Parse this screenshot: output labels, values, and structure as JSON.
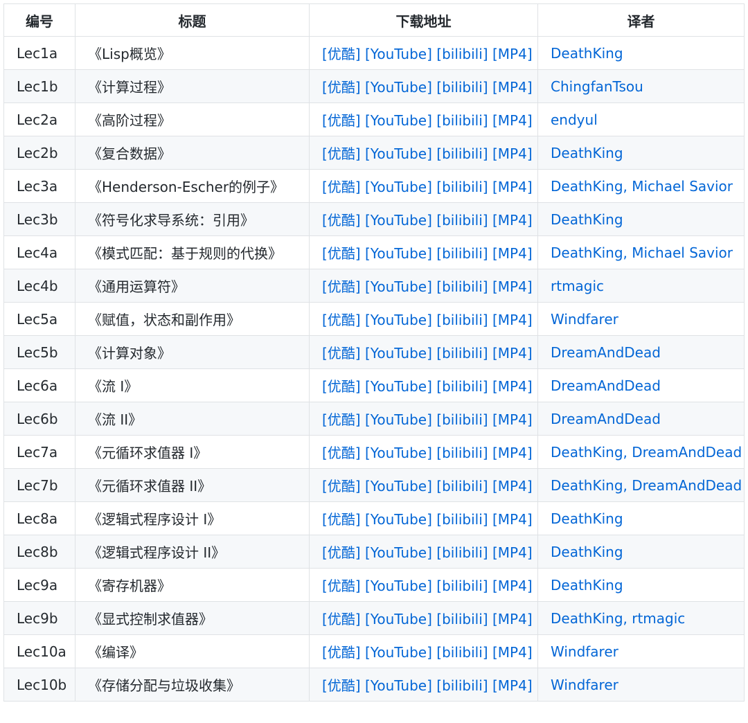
{
  "colors": {
    "link": "#0366d6",
    "border": "#dfe2e5",
    "stripe": "#f6f8fa",
    "text": "#24292e"
  },
  "table": {
    "headers": [
      "编号",
      "标题",
      "下载地址",
      "译者"
    ],
    "rows": [
      {
        "id": "Lec1a",
        "title": "《Lisp概览》",
        "links": [
          "[优酷]",
          "[YouTube]",
          "[bilibili]",
          "[MP4]"
        ],
        "translator": "DeathKing"
      },
      {
        "id": "Lec1b",
        "title": "《计算过程》",
        "links": [
          "[优酷]",
          "[YouTube]",
          "[bilibili]",
          "[MP4]"
        ],
        "translator": "ChingfanTsou"
      },
      {
        "id": "Lec2a",
        "title": "《高阶过程》",
        "links": [
          "[优酷]",
          "[YouTube]",
          "[bilibili]",
          "[MP4]"
        ],
        "translator": "endyul"
      },
      {
        "id": "Lec2b",
        "title": "《复合数据》",
        "links": [
          "[优酷]",
          "[YouTube]",
          "[bilibili]",
          "[MP4]"
        ],
        "translator": "DeathKing"
      },
      {
        "id": "Lec3a",
        "title": "《Henderson-Escher的例子》",
        "links": [
          "[优酷]",
          "[YouTube]",
          "[bilibili]",
          "[MP4]"
        ],
        "translator": "DeathKing, Michael Savior"
      },
      {
        "id": "Lec3b",
        "title": "《符号化求导系统：引用》",
        "links": [
          "[优酷]",
          "[YouTube]",
          "[bilibili]",
          "[MP4]"
        ],
        "translator": "DeathKing"
      },
      {
        "id": "Lec4a",
        "title": "《模式匹配：基于规则的代换》",
        "links": [
          "[优酷]",
          "[YouTube]",
          "[bilibili]",
          "[MP4]"
        ],
        "translator": "DeathKing, Michael Savior"
      },
      {
        "id": "Lec4b",
        "title": "《通用运算符》",
        "links": [
          "[优酷]",
          "[YouTube]",
          "[bilibili]",
          "[MP4]"
        ],
        "translator": "rtmagic"
      },
      {
        "id": "Lec5a",
        "title": "《赋值，状态和副作用》",
        "links": [
          "[优酷]",
          "[YouTube]",
          "[bilibili]",
          "[MP4]"
        ],
        "translator": "Windfarer"
      },
      {
        "id": "Lec5b",
        "title": "《计算对象》",
        "links": [
          "[优酷]",
          "[YouTube]",
          "[bilibili]",
          "[MP4]"
        ],
        "translator": "DreamAndDead"
      },
      {
        "id": "Lec6a",
        "title": "《流 I》",
        "links": [
          "[优酷]",
          "[YouTube]",
          "[bilibili]",
          "[MP4]"
        ],
        "translator": "DreamAndDead"
      },
      {
        "id": "Lec6b",
        "title": "《流 II》",
        "links": [
          "[优酷]",
          "[YouTube]",
          "[bilibili]",
          "[MP4]"
        ],
        "translator": "DreamAndDead"
      },
      {
        "id": "Lec7a",
        "title": "《元循环求值器 I》",
        "links": [
          "[优酷]",
          "[YouTube]",
          "[bilibili]",
          "[MP4]"
        ],
        "translator": "DeathKing, DreamAndDead"
      },
      {
        "id": "Lec7b",
        "title": "《元循环求值器 II》",
        "links": [
          "[优酷]",
          "[YouTube]",
          "[bilibili]",
          "[MP4]"
        ],
        "translator": "DeathKing, DreamAndDead"
      },
      {
        "id": "Lec8a",
        "title": "《逻辑式程序设计 I》",
        "links": [
          "[优酷]",
          "[YouTube]",
          "[bilibili]",
          "[MP4]"
        ],
        "translator": "DeathKing"
      },
      {
        "id": "Lec8b",
        "title": "《逻辑式程序设计 II》",
        "links": [
          "[优酷]",
          "[YouTube]",
          "[bilibili]",
          "[MP4]"
        ],
        "translator": "DeathKing"
      },
      {
        "id": "Lec9a",
        "title": "《寄存机器》",
        "links": [
          "[优酷]",
          "[YouTube]",
          "[bilibili]",
          "[MP4]"
        ],
        "translator": "DeathKing"
      },
      {
        "id": "Lec9b",
        "title": "《显式控制求值器》",
        "links": [
          "[优酷]",
          "[YouTube]",
          "[bilibili]",
          "[MP4]"
        ],
        "translator": "DeathKing, rtmagic"
      },
      {
        "id": "Lec10a",
        "title": "《编译》",
        "links": [
          "[优酷]",
          "[YouTube]",
          "[bilibili]",
          "[MP4]"
        ],
        "translator": "Windfarer"
      },
      {
        "id": "Lec10b",
        "title": "《存储分配与垃圾收集》",
        "links": [
          "[优酷]",
          "[YouTube]",
          "[bilibili]",
          "[MP4]"
        ],
        "translator": "Windfarer"
      }
    ]
  }
}
